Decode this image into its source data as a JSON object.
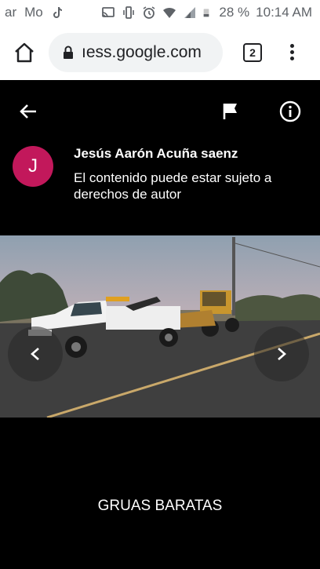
{
  "status_bar": {
    "left_items": [
      "ar",
      "Mo"
    ],
    "battery": "28 %",
    "time": "10:14 AM",
    "icons": [
      "tiktok-icon",
      "cast-icon",
      "vibrate-icon",
      "alarm-icon",
      "wifi-icon",
      "signal-icon",
      "battery-icon"
    ]
  },
  "browser": {
    "url": "ıess.google.com",
    "tab_count": "2",
    "icons": [
      "home-icon",
      "lock-icon",
      "tabs-icon",
      "more-vert-icon"
    ]
  },
  "viewer": {
    "author_initial": "J",
    "author_name": "Jesús Aarón Acuña saenz",
    "copyright_notice": "El contenido puede estar sujeto a derechos de autor",
    "caption": "GRUAS BARATAS",
    "avatar_color": "#c2185b",
    "icons": [
      "back-arrow-icon",
      "flag-icon",
      "info-icon",
      "chevron-left-icon",
      "chevron-right-icon"
    ]
  }
}
